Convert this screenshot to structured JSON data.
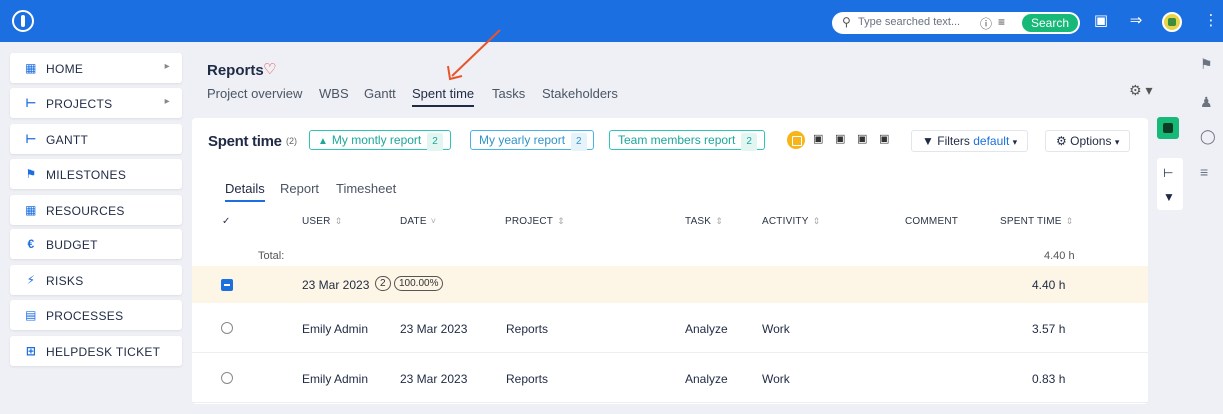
{
  "topbar": {
    "search_placeholder": "Type searched text...",
    "search_button": "Search",
    "color": "#1c6fe0"
  },
  "sidebar": {
    "items": [
      {
        "label": "HOME",
        "icon": "grid-icon",
        "arrow": true
      },
      {
        "label": "PROJECTS",
        "icon": "tree-icon",
        "arrow": true
      },
      {
        "label": "GANTT",
        "icon": "gantt-icon",
        "arrow": false
      },
      {
        "label": "MILESTONES",
        "icon": "flag-icon",
        "arrow": false
      },
      {
        "label": "RESOURCES",
        "icon": "grid-icon",
        "arrow": false
      },
      {
        "label": "BUDGET",
        "icon": "euro-icon",
        "arrow": false
      },
      {
        "label": "RISKS",
        "icon": "bolt-icon",
        "arrow": false
      },
      {
        "label": "PROCESSES",
        "icon": "process-icon",
        "arrow": false
      },
      {
        "label": "HELPDESK TICKET",
        "icon": "plus-icon",
        "arrow": false
      }
    ]
  },
  "header": {
    "title": "Reports",
    "tabs": [
      "Project overview",
      "WBS",
      "Gantt",
      "Spent time",
      "Tasks",
      "Stakeholders"
    ],
    "active_tab": "Spent time"
  },
  "card": {
    "title": "Spent time",
    "count": "(2)",
    "saved_queries": [
      {
        "label": "My montly report",
        "count": "2"
      },
      {
        "label": "My yearly report",
        "count": "2"
      },
      {
        "label": "Team members report",
        "count": "2"
      }
    ],
    "filters_label": "Filters",
    "filters_value": "default",
    "options_label": "Options",
    "subtabs": [
      "Details",
      "Report",
      "Timesheet"
    ],
    "columns": [
      "USER",
      "DATE",
      "PROJECT",
      "TASK",
      "ACTIVITY",
      "COMMENT",
      "SPENT TIME"
    ],
    "total_label": "Total:",
    "total_value": "4.40 h",
    "group": {
      "date": "23 Mar 2023",
      "count": "2",
      "percent": "100.00%",
      "sum": "4.40 h"
    },
    "rows": [
      {
        "user": "Emily Admin",
        "date": "23 Mar 2023",
        "project": "Reports",
        "task": "Analyze",
        "activity": "Work",
        "comment": "",
        "spent": "3.57 h"
      },
      {
        "user": "Emily Admin",
        "date": "23 Mar 2023",
        "project": "Reports",
        "task": "Analyze",
        "activity": "Work",
        "comment": "",
        "spent": "0.83 h"
      }
    ]
  }
}
